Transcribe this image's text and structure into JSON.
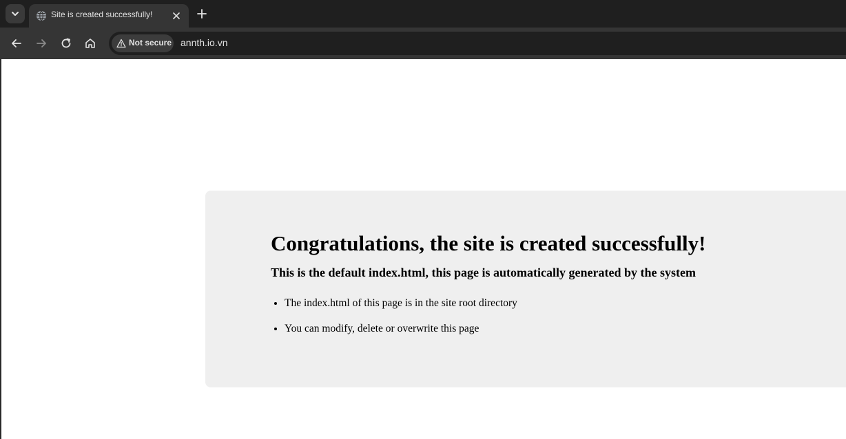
{
  "browser": {
    "tab": {
      "title": "Site is created successfully!"
    },
    "omnibox": {
      "security_label": "Not secure",
      "url": "annth.io.vn"
    },
    "icons": {
      "tab_search": "chevron-down-icon",
      "favicon": "globe-icon",
      "tab_close": "close-icon",
      "new_tab": "plus-icon",
      "back": "arrow-left-icon",
      "forward": "arrow-right-icon",
      "reload": "reload-icon",
      "home": "home-icon",
      "security": "warning-icon"
    }
  },
  "page": {
    "headline": "Congratulations, the site is created successfully!",
    "subheadline": "This is the default index.html, this page is automatically generated by the system",
    "bullets": [
      "The index.html of this page is in the site root directory",
      "You can modify, delete or overwrite this page"
    ],
    "colors": {
      "panel_background": "#efefef",
      "chrome_dark": "#1f1f1f",
      "chrome_toolbar": "#353535"
    }
  }
}
